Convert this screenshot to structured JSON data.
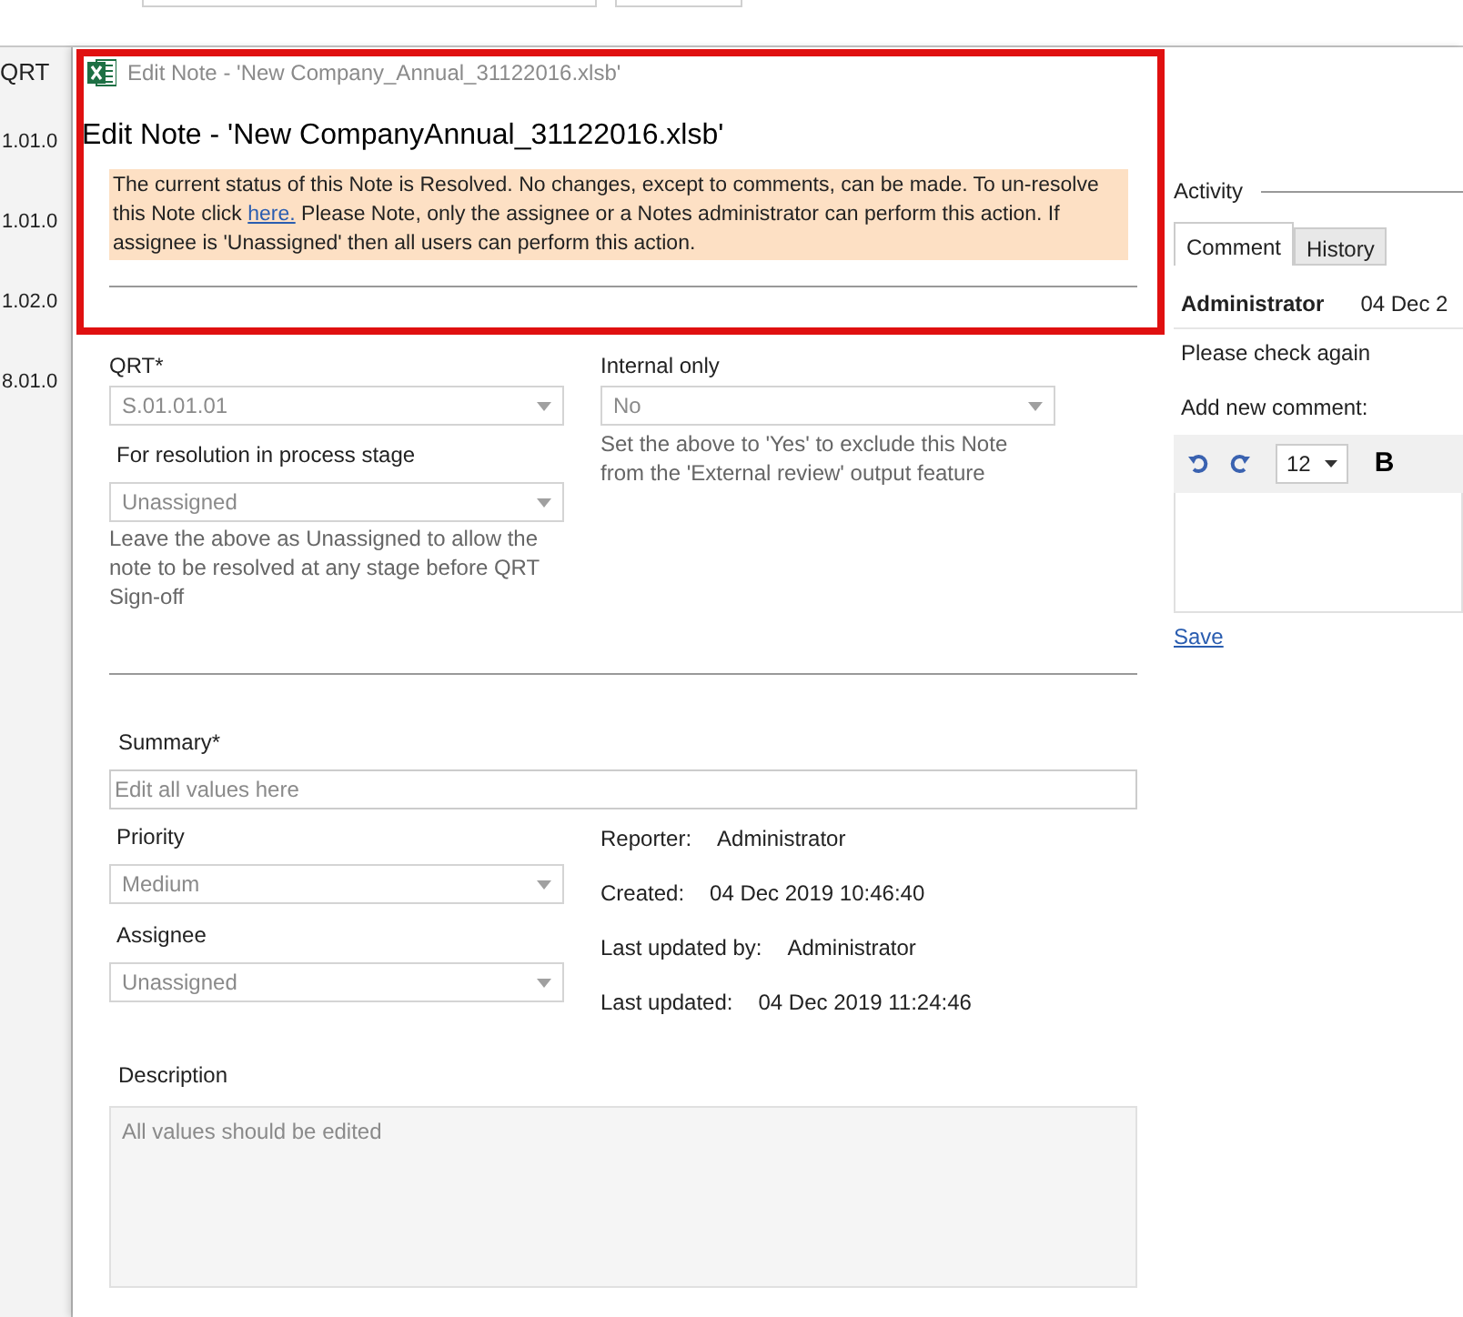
{
  "background_sheet": {
    "header": "QRT",
    "cells": [
      "1.01.0",
      "1.01.0",
      "1.02.0",
      "8.01.0"
    ]
  },
  "window": {
    "title": "Edit Note - 'New Company_Annual_31122016.xlsb'"
  },
  "heading": "Edit Note - 'New CompanyAnnual_31122016.xlsb'",
  "banner": {
    "text_before": "The current status of this Note is Resolved. No changes, except to comments, can be made. To un-resolve this Note click ",
    "link": "here.",
    "text_after": " Please Note, only the assignee or a Notes administrator can perform this action. If assignee is 'Unassigned' then all users can perform this action."
  },
  "qrt": {
    "label": "QRT*",
    "value": "S.01.01.01",
    "disabled": true
  },
  "stage": {
    "label": "For resolution in process stage",
    "value": "Unassigned",
    "disabled": true,
    "help": "Leave the above as Unassigned to allow the note to be resolved at any stage before QRT Sign-off"
  },
  "internal": {
    "label": "Internal only",
    "value": "No",
    "disabled": true,
    "help": "Set the above to 'Yes' to exclude this Note from the 'External review' output feature"
  },
  "summary": {
    "label": "Summary*",
    "value": "Edit all values here",
    "disabled": true
  },
  "priority": {
    "label": "Priority",
    "value": "Medium",
    "disabled": true
  },
  "assignee": {
    "label": "Assignee",
    "value": "Unassigned",
    "disabled": true
  },
  "meta": [
    {
      "label": "Reporter:",
      "value": "Administrator"
    },
    {
      "label": "Created:",
      "value": "04 Dec 2019 10:46:40"
    },
    {
      "label": "Last updated by:",
      "value": "Administrator"
    },
    {
      "label": "Last updated:",
      "value": "04 Dec 2019 11:24:46"
    }
  ],
  "description": {
    "label": "Description",
    "value": "All values should be edited",
    "disabled": true
  },
  "activity": {
    "title": "Activity",
    "tabs": [
      {
        "label": "Comment",
        "selected": true
      },
      {
        "label": "History",
        "selected": false
      }
    ],
    "comment": {
      "author": "Administrator",
      "date": "04 Dec 2",
      "text": "Please check again"
    },
    "add_label": "Add new comment:",
    "font_size": "12",
    "bold": "B",
    "save": "Save"
  }
}
